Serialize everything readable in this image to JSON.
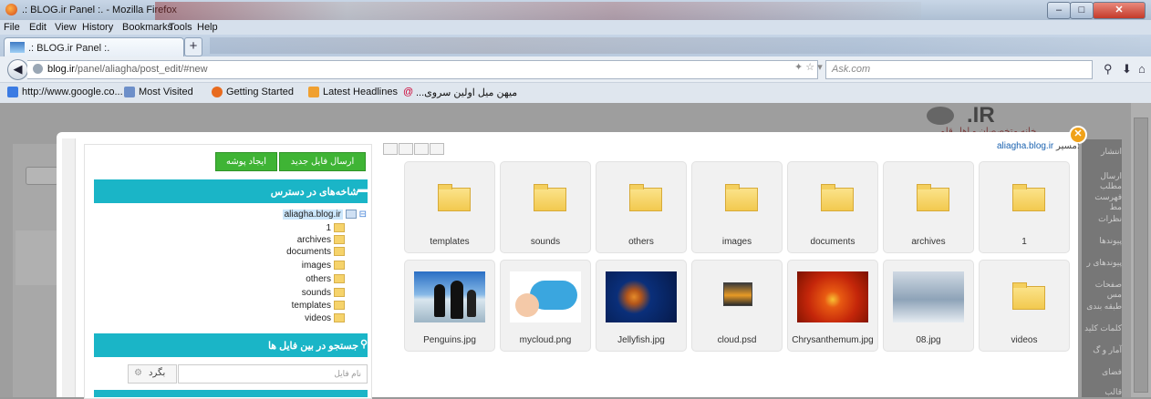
{
  "window": {
    "title": ".: BLOG.ir Panel :. - Mozilla Firefox",
    "min": "–",
    "max": "□",
    "close": "✕"
  },
  "menu": [
    "File",
    "Edit",
    "View",
    "History",
    "Bookmarks",
    "Tools",
    "Help"
  ],
  "tab": {
    "label": ".: BLOG.ir Panel :.",
    "new": "+"
  },
  "nav": {
    "url_host": "blog.ir",
    "url_path": "/panel/aliagha/post_edit/#new",
    "search_placeholder": "Ask.com"
  },
  "bookmarks": [
    "http://www.google.co...",
    "Most Visited",
    "Getting Started",
    "Latest Headlines",
    "...میهن میل اولین سروی"
  ],
  "sidebar": {
    "items": [
      "انتشار",
      "ارسال مطلب",
      "فهرست مط",
      "نظرات",
      "پیوندها",
      "پیوندهای ر",
      "صفحات مس",
      "طبقه بندی",
      "کلمات کلید",
      "آمار و گ",
      "فضای",
      "قالب"
    ]
  },
  "left_panel": {
    "btn_upload": "ارسال فایل جدید",
    "btn_new_folder": "ایجاد پوشه جدید",
    "folders_header": "شاخه‌های در دسترس",
    "search_header": "جستجو در بین فایل ها",
    "file_name_placeholder": "نام فایل",
    "back_label": "بگرد",
    "tree_root": "aliagha.blog.ir",
    "tree": [
      "1",
      "archives",
      "documents",
      "images",
      "others",
      "sounds",
      "templates",
      "videos"
    ]
  },
  "path": {
    "label": "مسیر:",
    "value": "aliagha.blog.ir"
  },
  "files_row1": [
    "templates",
    "sounds",
    "others",
    "images",
    "documents",
    "archives",
    "1"
  ],
  "files_row2": [
    "Penguins.jpg",
    "mycloud.png",
    "Jellyfish.jpg",
    "cloud.psd",
    "Chrysanthemum.jpg",
    "08.jpg",
    "videos"
  ],
  "logo_text": ".IR",
  "logo_sub": "خانه متخصصان و اهل قلم"
}
